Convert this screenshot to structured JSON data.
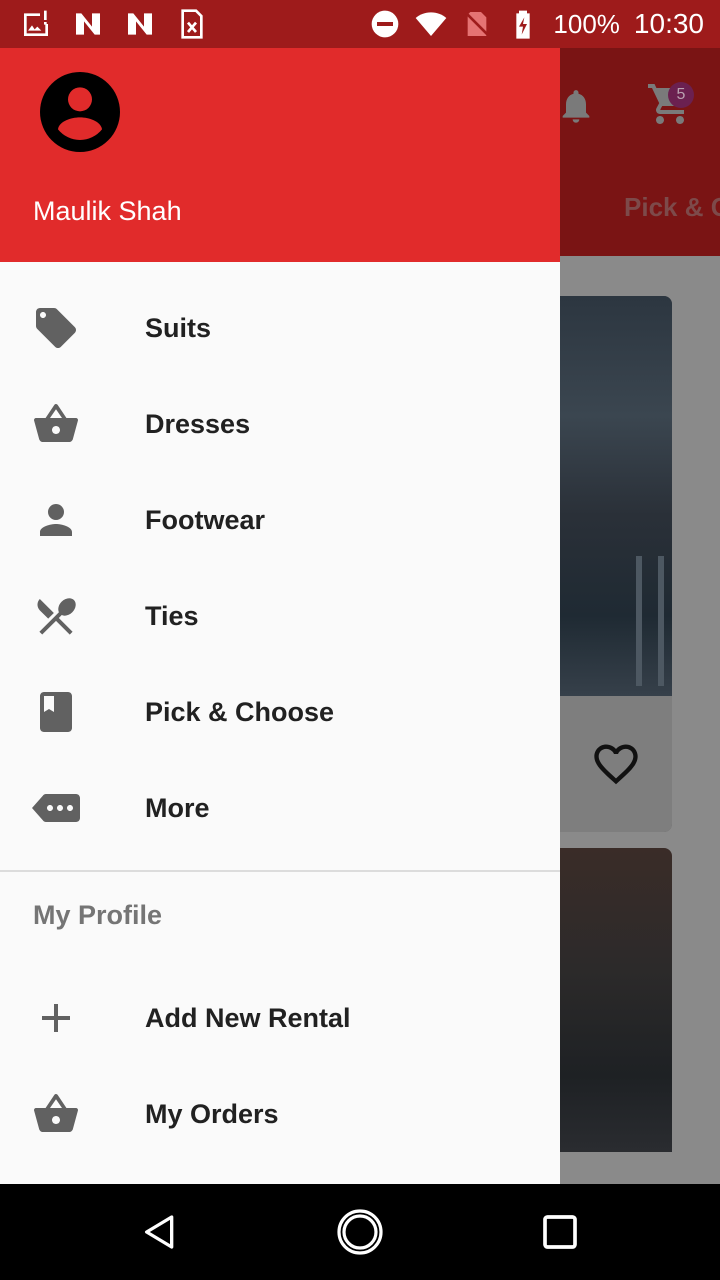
{
  "status_bar": {
    "left_icons": [
      "gallery-alert-icon",
      "n-notification-icon",
      "n-notification-icon",
      "document-x-icon"
    ],
    "right_icons": [
      "do-not-disturb-icon",
      "wifi-icon",
      "no-sim-icon",
      "battery-charging-icon"
    ],
    "battery": "100%",
    "time": "10:30"
  },
  "app": {
    "cart_badge": "5",
    "visible_tab": "Pick & C"
  },
  "drawer": {
    "user_name": "Maulik Shah",
    "header_color": "#e12b2b",
    "menu": [
      {
        "label": "Suits",
        "icon": "tag-icon"
      },
      {
        "label": "Dresses",
        "icon": "basket-icon"
      },
      {
        "label": "Footwear",
        "icon": "person-icon"
      },
      {
        "label": "Ties",
        "icon": "restaurant-icon"
      },
      {
        "label": "Pick & Choose",
        "icon": "book-icon"
      },
      {
        "label": "More",
        "icon": "more-label-icon"
      }
    ],
    "section_title": "My Profile",
    "profile_menu": [
      {
        "label": "Add New Rental",
        "icon": "plus-icon"
      },
      {
        "label": "My Orders",
        "icon": "basket-icon"
      }
    ]
  },
  "nav_bar": {
    "buttons": [
      "back-icon",
      "home-icon",
      "recents-icon"
    ]
  }
}
